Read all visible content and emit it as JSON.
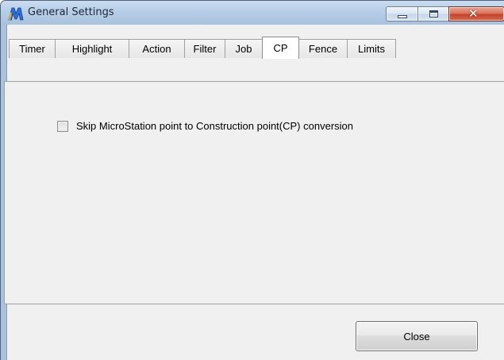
{
  "window": {
    "title": "General Settings",
    "app_icon": "microstation-m-icon",
    "caption_buttons": [
      "minimize-icon",
      "maximize-icon",
      "close-icon"
    ]
  },
  "tabs": [
    {
      "label": "Timer",
      "active": false
    },
    {
      "label": "Highlight",
      "active": false
    },
    {
      "label": "Action",
      "active": false
    },
    {
      "label": "Filter",
      "active": false
    },
    {
      "label": "Job",
      "active": false
    },
    {
      "label": "CP",
      "active": true
    },
    {
      "label": "Fence",
      "active": false
    },
    {
      "label": "Limits",
      "active": false
    }
  ],
  "cp_panel": {
    "checkbox_label": "Skip MicroStation point to Construction point(CP) conversion",
    "checked": false
  },
  "footer": {
    "close_label": "Close"
  },
  "colors": {
    "accent_title": "#1e2733",
    "close_caption": "#c4432a",
    "app_icon": "#2f6fd6"
  }
}
